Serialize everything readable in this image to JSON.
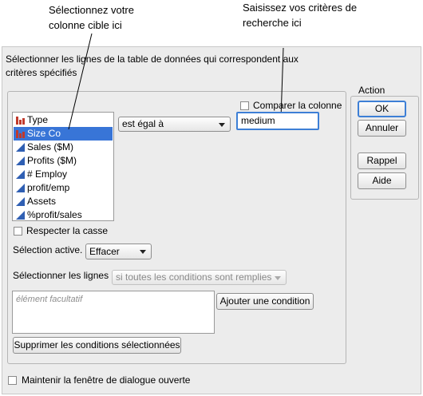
{
  "callouts": {
    "left": [
      "Sélectionnez votre",
      "colonne cible ici"
    ],
    "right": [
      "Saisissez vos critères de",
      "recherche ici"
    ]
  },
  "dialog": {
    "description": "Sélectionner les lignes de la table de données qui correspondent aux critères spécifiés",
    "columns": [
      {
        "label": "Type",
        "icon": "nominal-bar-icon",
        "selected": false
      },
      {
        "label": "Size Co",
        "icon": "nominal-bar-icon",
        "selected": true
      },
      {
        "label": "Sales ($M)",
        "icon": "continuous-triangle-icon",
        "selected": false
      },
      {
        "label": "Profits ($M)",
        "icon": "continuous-triangle-icon",
        "selected": false
      },
      {
        "label": "# Employ",
        "icon": "continuous-triangle-icon",
        "selected": false
      },
      {
        "label": "profit/emp",
        "icon": "continuous-triangle-icon",
        "selected": false
      },
      {
        "label": "Assets",
        "icon": "continuous-triangle-icon",
        "selected": false
      },
      {
        "label": "%profit/sales",
        "icon": "continuous-triangle-icon",
        "selected": false
      }
    ],
    "operator": "est égal à",
    "compare_column_label": "Comparer la colonne",
    "search_value": "medium",
    "match_case_label": "Respecter la casse",
    "active_selection_label": "Sélection active.",
    "active_selection_value": "Effacer",
    "select_rows_label": "Sélectionner les lignes",
    "select_rows_value": "si toutes les conditions sont remplies",
    "conditions_placeholder": "élément facultatif",
    "add_condition": "Ajouter une condition",
    "remove_conditions": "Supprimer les conditions sélectionnées",
    "keep_open_label": "Maintenir la fenêtre de dialogue ouverte"
  },
  "action": {
    "title": "Action",
    "ok": "OK",
    "cancel": "Annuler",
    "recall": "Rappel",
    "help": "Aide"
  },
  "colors": {
    "selection": "#3875d7",
    "nominal_icon": "#c0392b",
    "continuous_icon": "#2f5fb3",
    "focus": "#3d7fd6"
  }
}
